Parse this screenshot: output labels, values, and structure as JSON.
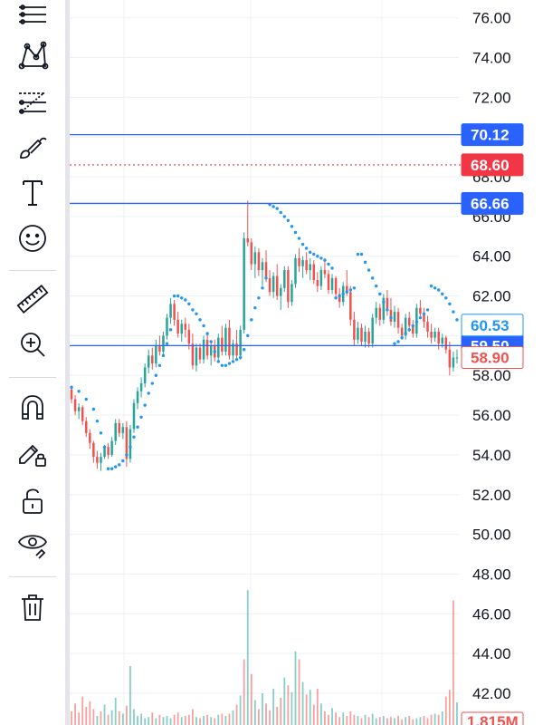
{
  "toolbar": {
    "tools": [
      {
        "name": "lines-tool",
        "icon": "horizontal-lines-icon"
      },
      {
        "name": "pattern-tool",
        "icon": "xabcd-pattern-icon"
      },
      {
        "name": "fib-tool",
        "icon": "fib-retracement-icon"
      },
      {
        "name": "brush-tool",
        "icon": "brush-icon"
      },
      {
        "name": "text-tool",
        "icon": "text-icon"
      },
      {
        "name": "emoji-tool",
        "icon": "smiley-icon"
      },
      {
        "name": "measure-tool",
        "icon": "ruler-icon"
      },
      {
        "name": "zoom-tool",
        "icon": "zoom-in-icon"
      },
      {
        "name": "magnet-tool",
        "icon": "magnet-icon"
      },
      {
        "name": "lock-drawing-tool",
        "icon": "pencil-lock-icon"
      },
      {
        "name": "lock-all-tool",
        "icon": "unlock-icon"
      },
      {
        "name": "hide-tool",
        "icon": "eye-icon"
      },
      {
        "name": "delete-tool",
        "icon": "trash-icon"
      }
    ]
  },
  "colors": {
    "up": "#26a69a",
    "down": "#ef5350",
    "sar": "#2196f3",
    "hline": "#2962ff",
    "dotted": "#f23645",
    "grid": "#eef0f3",
    "text": "#131722"
  },
  "chart_data": {
    "type": "candlestick",
    "ylim": [
      40.4,
      76.9
    ],
    "yticks": [
      "76.00",
      "74.00",
      "72.00",
      "70.00",
      "68.00",
      "66.00",
      "64.00",
      "62.00",
      "60.00",
      "58.00",
      "56.00",
      "54.00",
      "52.00",
      "50.00",
      "48.00",
      "46.00",
      "44.00",
      "42.00"
    ],
    "last_close": 58.9,
    "sar_value": 60.53,
    "horizontal_lines": [
      {
        "value": 70.12,
        "label": "70.12",
        "style": "solid"
      },
      {
        "value": 66.66,
        "label": "66.66",
        "style": "solid"
      },
      {
        "value": 59.5,
        "label": "59.50",
        "style": "solid"
      },
      {
        "value": 68.6,
        "label": "68.60",
        "style": "dotted"
      }
    ],
    "volume_label": "1.815M",
    "candles": [
      [
        57.3,
        57.5,
        56.6,
        56.8
      ],
      [
        56.8,
        57.0,
        56.0,
        56.2
      ],
      [
        56.2,
        56.6,
        55.8,
        56.4
      ],
      [
        56.4,
        56.5,
        55.5,
        55.7
      ],
      [
        55.7,
        55.9,
        54.9,
        55.1
      ],
      [
        55.1,
        55.3,
        54.3,
        54.6
      ],
      [
        54.6,
        54.7,
        53.6,
        53.9
      ],
      [
        53.9,
        54.2,
        53.3,
        53.6
      ],
      [
        53.6,
        54.1,
        53.2,
        53.9
      ],
      [
        53.9,
        54.5,
        53.8,
        54.4
      ],
      [
        54.4,
        54.6,
        53.8,
        54.0
      ],
      [
        54.0,
        54.9,
        53.9,
        54.7
      ],
      [
        54.7,
        55.8,
        54.5,
        55.6
      ],
      [
        55.6,
        55.8,
        54.9,
        55.1
      ],
      [
        55.1,
        55.6,
        54.8,
        55.4
      ],
      [
        55.4,
        55.7,
        53.4,
        53.8
      ],
      [
        53.8,
        55.5,
        53.6,
        55.3
      ],
      [
        55.3,
        56.8,
        55.1,
        56.6
      ],
      [
        56.6,
        57.4,
        56.3,
        57.2
      ],
      [
        57.2,
        57.9,
        56.9,
        57.6
      ],
      [
        57.6,
        58.6,
        57.4,
        58.4
      ],
      [
        58.4,
        59.3,
        58.1,
        59.0
      ],
      [
        59.0,
        59.4,
        58.3,
        58.6
      ],
      [
        58.6,
        59.8,
        58.4,
        59.5
      ],
      [
        59.5,
        60.0,
        59.0,
        59.2
      ],
      [
        59.2,
        60.2,
        59.0,
        60.0
      ],
      [
        60.0,
        61.1,
        59.8,
        60.9
      ],
      [
        60.9,
        61.9,
        60.6,
        61.6
      ],
      [
        61.6,
        61.8,
        60.5,
        60.8
      ],
      [
        60.8,
        61.2,
        59.9,
        60.1
      ],
      [
        60.1,
        60.8,
        59.7,
        60.6
      ],
      [
        60.6,
        60.9,
        59.9,
        60.3
      ],
      [
        60.3,
        60.6,
        59.3,
        59.6
      ],
      [
        59.6,
        60.1,
        58.3,
        58.5
      ],
      [
        58.5,
        59.6,
        58.2,
        59.4
      ],
      [
        59.4,
        59.6,
        58.6,
        58.8
      ],
      [
        58.8,
        60.0,
        58.6,
        59.8
      ],
      [
        59.8,
        60.2,
        58.8,
        59.0
      ],
      [
        59.0,
        59.7,
        58.5,
        59.5
      ],
      [
        59.5,
        59.8,
        58.7,
        58.9
      ],
      [
        58.9,
        60.1,
        58.7,
        59.9
      ],
      [
        59.9,
        60.5,
        59.0,
        59.2
      ],
      [
        59.2,
        60.6,
        59.0,
        60.4
      ],
      [
        60.4,
        60.8,
        58.8,
        59.0
      ],
      [
        59.0,
        59.8,
        58.8,
        59.6
      ],
      [
        59.6,
        60.3,
        58.8,
        59.0
      ],
      [
        59.0,
        60.5,
        58.8,
        60.3
      ],
      [
        60.3,
        65.2,
        60.1,
        64.9
      ],
      [
        64.9,
        66.8,
        64.5,
        64.7
      ],
      [
        64.7,
        64.9,
        63.3,
        63.6
      ],
      [
        63.6,
        64.5,
        62.9,
        64.2
      ],
      [
        64.2,
        64.4,
        63.0,
        63.3
      ],
      [
        63.3,
        63.9,
        62.5,
        63.7
      ],
      [
        63.7,
        64.3,
        62.7,
        62.9
      ],
      [
        62.9,
        63.3,
        62.0,
        62.2
      ],
      [
        62.2,
        63.2,
        61.9,
        63.0
      ],
      [
        63.0,
        63.6,
        61.8,
        62.0
      ],
      [
        62.0,
        62.6,
        61.3,
        62.4
      ],
      [
        62.4,
        63.5,
        62.2,
        63.3
      ],
      [
        63.3,
        63.5,
        61.4,
        61.7
      ],
      [
        61.7,
        62.8,
        61.5,
        62.6
      ],
      [
        62.6,
        64.1,
        62.4,
        63.9
      ],
      [
        63.9,
        64.4,
        63.2,
        63.5
      ],
      [
        63.5,
        64.0,
        62.9,
        63.8
      ],
      [
        63.8,
        64.2,
        63.1,
        63.3
      ],
      [
        63.3,
        63.9,
        62.8,
        63.6
      ],
      [
        63.6,
        63.8,
        62.6,
        62.8
      ],
      [
        62.8,
        63.2,
        62.2,
        62.5
      ],
      [
        62.5,
        63.5,
        62.3,
        63.3
      ],
      [
        63.3,
        63.9,
        62.9,
        63.1
      ],
      [
        63.1,
        63.3,
        62.1,
        62.3
      ],
      [
        62.3,
        63.1,
        62.1,
        62.9
      ],
      [
        62.9,
        63.0,
        61.9,
        62.1
      ],
      [
        62.1,
        62.4,
        61.4,
        61.7
      ],
      [
        61.7,
        62.7,
        61.5,
        62.5
      ],
      [
        62.5,
        63.3,
        62.0,
        62.2
      ],
      [
        62.2,
        62.5,
        60.5,
        60.8
      ],
      [
        60.8,
        61.2,
        59.5,
        59.8
      ],
      [
        59.8,
        60.7,
        59.6,
        60.4
      ],
      [
        60.4,
        60.6,
        59.5,
        59.7
      ],
      [
        59.7,
        60.5,
        59.4,
        60.2
      ],
      [
        60.2,
        60.4,
        59.4,
        59.6
      ],
      [
        59.6,
        61.1,
        59.4,
        60.9
      ],
      [
        60.9,
        61.7,
        60.6,
        61.4
      ],
      [
        61.4,
        61.6,
        60.5,
        60.8
      ],
      [
        60.8,
        62.1,
        60.6,
        61.9
      ],
      [
        61.9,
        62.3,
        61.0,
        61.3
      ],
      [
        61.3,
        61.9,
        60.5,
        60.7
      ],
      [
        60.7,
        61.5,
        60.4,
        61.2
      ],
      [
        61.2,
        61.4,
        60.1,
        60.4
      ],
      [
        60.4,
        60.6,
        59.8,
        60.0
      ],
      [
        60.0,
        61.1,
        59.8,
        60.9
      ],
      [
        60.9,
        61.2,
        60.2,
        60.5
      ],
      [
        60.5,
        60.8,
        59.9,
        60.1
      ],
      [
        60.1,
        61.6,
        59.9,
        61.4
      ],
      [
        61.4,
        61.8,
        60.9,
        61.1
      ],
      [
        61.1,
        61.4,
        60.4,
        60.7
      ],
      [
        60.7,
        61.0,
        59.9,
        60.2
      ],
      [
        60.2,
        60.6,
        59.6,
        59.9
      ],
      [
        59.9,
        60.4,
        59.7,
        60.2
      ],
      [
        60.2,
        60.4,
        59.3,
        59.6
      ],
      [
        59.6,
        60.1,
        59.4,
        59.9
      ],
      [
        59.9,
        60.0,
        59.1,
        59.3
      ],
      [
        59.3,
        59.7,
        58.0,
        58.4
      ],
      [
        58.4,
        59.2,
        58.2,
        58.9
      ],
      [
        58.9,
        59.3,
        58.6,
        58.9
      ]
    ],
    "sar": [
      [
        0,
        57.4
      ],
      [
        2,
        57.2
      ],
      [
        4,
        56.8
      ],
      [
        6,
        56.3
      ],
      [
        7,
        55.7
      ],
      [
        8,
        55.1
      ],
      [
        9,
        54.4
      ],
      [
        10,
        53.3
      ],
      [
        11,
        53.3
      ],
      [
        12,
        53.4
      ],
      [
        13,
        53.5
      ],
      [
        14,
        53.7
      ],
      [
        15,
        54.0
      ],
      [
        16,
        54.4
      ],
      [
        17,
        54.9
      ],
      [
        18,
        55.4
      ],
      [
        19,
        55.9
      ],
      [
        20,
        56.5
      ],
      [
        21,
        57.1
      ],
      [
        22,
        57.6
      ],
      [
        23,
        58.0
      ],
      [
        24,
        58.5
      ],
      [
        25,
        59.0
      ],
      [
        26,
        59.6
      ],
      [
        27,
        60.3
      ],
      [
        28,
        62.0
      ],
      [
        29,
        62.0
      ],
      [
        30,
        61.9
      ],
      [
        31,
        61.8
      ],
      [
        32,
        61.6
      ],
      [
        33,
        61.3
      ],
      [
        34,
        61.1
      ],
      [
        35,
        60.8
      ],
      [
        36,
        60.5
      ],
      [
        37,
        60.1
      ],
      [
        38,
        59.7
      ],
      [
        39,
        59.2
      ],
      [
        40,
        58.7
      ],
      [
        41,
        58.5
      ],
      [
        42,
        58.5
      ],
      [
        43,
        58.6
      ],
      [
        44,
        58.7
      ],
      [
        45,
        58.8
      ],
      [
        46,
        58.9
      ],
      [
        47,
        59.3
      ],
      [
        48,
        60.0
      ],
      [
        49,
        60.8
      ],
      [
        50,
        61.4
      ],
      [
        51,
        61.9
      ],
      [
        52,
        62.4
      ],
      [
        53,
        62.9
      ],
      [
        54,
        66.6
      ],
      [
        55,
        66.5
      ],
      [
        56,
        66.4
      ],
      [
        57,
        66.2
      ],
      [
        58,
        66.0
      ],
      [
        59,
        65.8
      ],
      [
        60,
        65.5
      ],
      [
        61,
        65.2
      ],
      [
        62,
        64.9
      ],
      [
        63,
        64.6
      ],
      [
        64,
        64.4
      ],
      [
        65,
        64.2
      ],
      [
        66,
        64.1
      ],
      [
        67,
        64.0
      ],
      [
        68,
        63.9
      ],
      [
        69,
        63.8
      ],
      [
        70,
        63.6
      ],
      [
        71,
        63.4
      ],
      [
        72,
        61.9
      ],
      [
        73,
        62.0
      ],
      [
        74,
        62.1
      ],
      [
        75,
        62.2
      ],
      [
        76,
        62.3
      ],
      [
        77,
        62.4
      ],
      [
        78,
        64.1
      ],
      [
        79,
        64.1
      ],
      [
        80,
        63.7
      ],
      [
        81,
        63.3
      ],
      [
        82,
        62.9
      ],
      [
        83,
        62.5
      ],
      [
        84,
        62.1
      ],
      [
        85,
        61.7
      ],
      [
        86,
        61.3
      ],
      [
        87,
        60.9
      ],
      [
        88,
        59.6
      ],
      [
        89,
        59.7
      ],
      [
        90,
        59.9
      ],
      [
        91,
        60.1
      ],
      [
        92,
        60.3
      ],
      [
        93,
        60.5
      ],
      [
        94,
        60.7
      ],
      [
        95,
        60.9
      ],
      [
        96,
        61.1
      ],
      [
        97,
        61.3
      ],
      [
        98,
        62.5
      ],
      [
        99,
        62.4
      ],
      [
        100,
        62.3
      ],
      [
        101,
        62.1
      ],
      [
        102,
        61.9
      ],
      [
        103,
        61.6
      ],
      [
        104,
        61.2
      ],
      [
        105,
        60.8
      ]
    ],
    "volume": [
      [
        1.2,
        0
      ],
      [
        1.9,
        0
      ],
      [
        1.1,
        0
      ],
      [
        2.5,
        0
      ],
      [
        1.6,
        0
      ],
      [
        2.1,
        0
      ],
      [
        1.4,
        0
      ],
      [
        0.8,
        1
      ],
      [
        1.2,
        0
      ],
      [
        1.8,
        1
      ],
      [
        0.9,
        0
      ],
      [
        1.3,
        1
      ],
      [
        2.4,
        1
      ],
      [
        1.2,
        0
      ],
      [
        1.0,
        1
      ],
      [
        1.7,
        0
      ],
      [
        5.2,
        1
      ],
      [
        1.4,
        1
      ],
      [
        0.8,
        1
      ],
      [
        1.0,
        1
      ],
      [
        0.6,
        1
      ],
      [
        0.7,
        1
      ],
      [
        1.1,
        0
      ],
      [
        0.6,
        1
      ],
      [
        0.9,
        0
      ],
      [
        0.7,
        1
      ],
      [
        0.8,
        1
      ],
      [
        0.6,
        1
      ],
      [
        0.9,
        0
      ],
      [
        1.1,
        0
      ],
      [
        0.7,
        1
      ],
      [
        0.8,
        0
      ],
      [
        0.9,
        0
      ],
      [
        1.4,
        0
      ],
      [
        0.7,
        1
      ],
      [
        0.6,
        0
      ],
      [
        0.8,
        1
      ],
      [
        0.9,
        0
      ],
      [
        0.7,
        1
      ],
      [
        0.6,
        0
      ],
      [
        0.9,
        1
      ],
      [
        1.0,
        0
      ],
      [
        0.8,
        1
      ],
      [
        1.0,
        0
      ],
      [
        1.3,
        1
      ],
      [
        1.8,
        0
      ],
      [
        2.6,
        1
      ],
      [
        5.8,
        0
      ],
      [
        11.9,
        1
      ],
      [
        4.5,
        0
      ],
      [
        2.2,
        1
      ],
      [
        1.4,
        0
      ],
      [
        2.8,
        1
      ],
      [
        1.9,
        0
      ],
      [
        1.3,
        0
      ],
      [
        3.2,
        1
      ],
      [
        1.6,
        0
      ],
      [
        2.4,
        0
      ],
      [
        4.2,
        1
      ],
      [
        3.5,
        0
      ],
      [
        2.9,
        1
      ],
      [
        6.5,
        1
      ],
      [
        5.8,
        0
      ],
      [
        3.8,
        1
      ],
      [
        2.7,
        0
      ],
      [
        3.1,
        1
      ],
      [
        1.8,
        0
      ],
      [
        3.2,
        0
      ],
      [
        1.9,
        1
      ],
      [
        1.2,
        0
      ],
      [
        0.9,
        0
      ],
      [
        1.5,
        1
      ],
      [
        1.1,
        0
      ],
      [
        0.7,
        0
      ],
      [
        1.1,
        1
      ],
      [
        0.8,
        0
      ],
      [
        1.2,
        0
      ],
      [
        0.9,
        0
      ],
      [
        0.8,
        1
      ],
      [
        0.6,
        0
      ],
      [
        0.9,
        1
      ],
      [
        0.7,
        0
      ],
      [
        1.0,
        1
      ],
      [
        0.6,
        1
      ],
      [
        0.7,
        0
      ],
      [
        0.8,
        1
      ],
      [
        0.6,
        0
      ],
      [
        0.7,
        0
      ],
      [
        0.6,
        1
      ],
      [
        0.8,
        0
      ],
      [
        0.5,
        0
      ],
      [
        0.7,
        1
      ],
      [
        0.8,
        0
      ],
      [
        0.5,
        0
      ],
      [
        0.6,
        1
      ],
      [
        0.7,
        1
      ],
      [
        0.8,
        0
      ],
      [
        0.6,
        0
      ],
      [
        0.9,
        0
      ],
      [
        1.0,
        1
      ],
      [
        0.9,
        0
      ],
      [
        1.2,
        1
      ],
      [
        2.5,
        0
      ],
      [
        3.1,
        0
      ],
      [
        11.0,
        0
      ],
      [
        2.0,
        1
      ]
    ]
  }
}
